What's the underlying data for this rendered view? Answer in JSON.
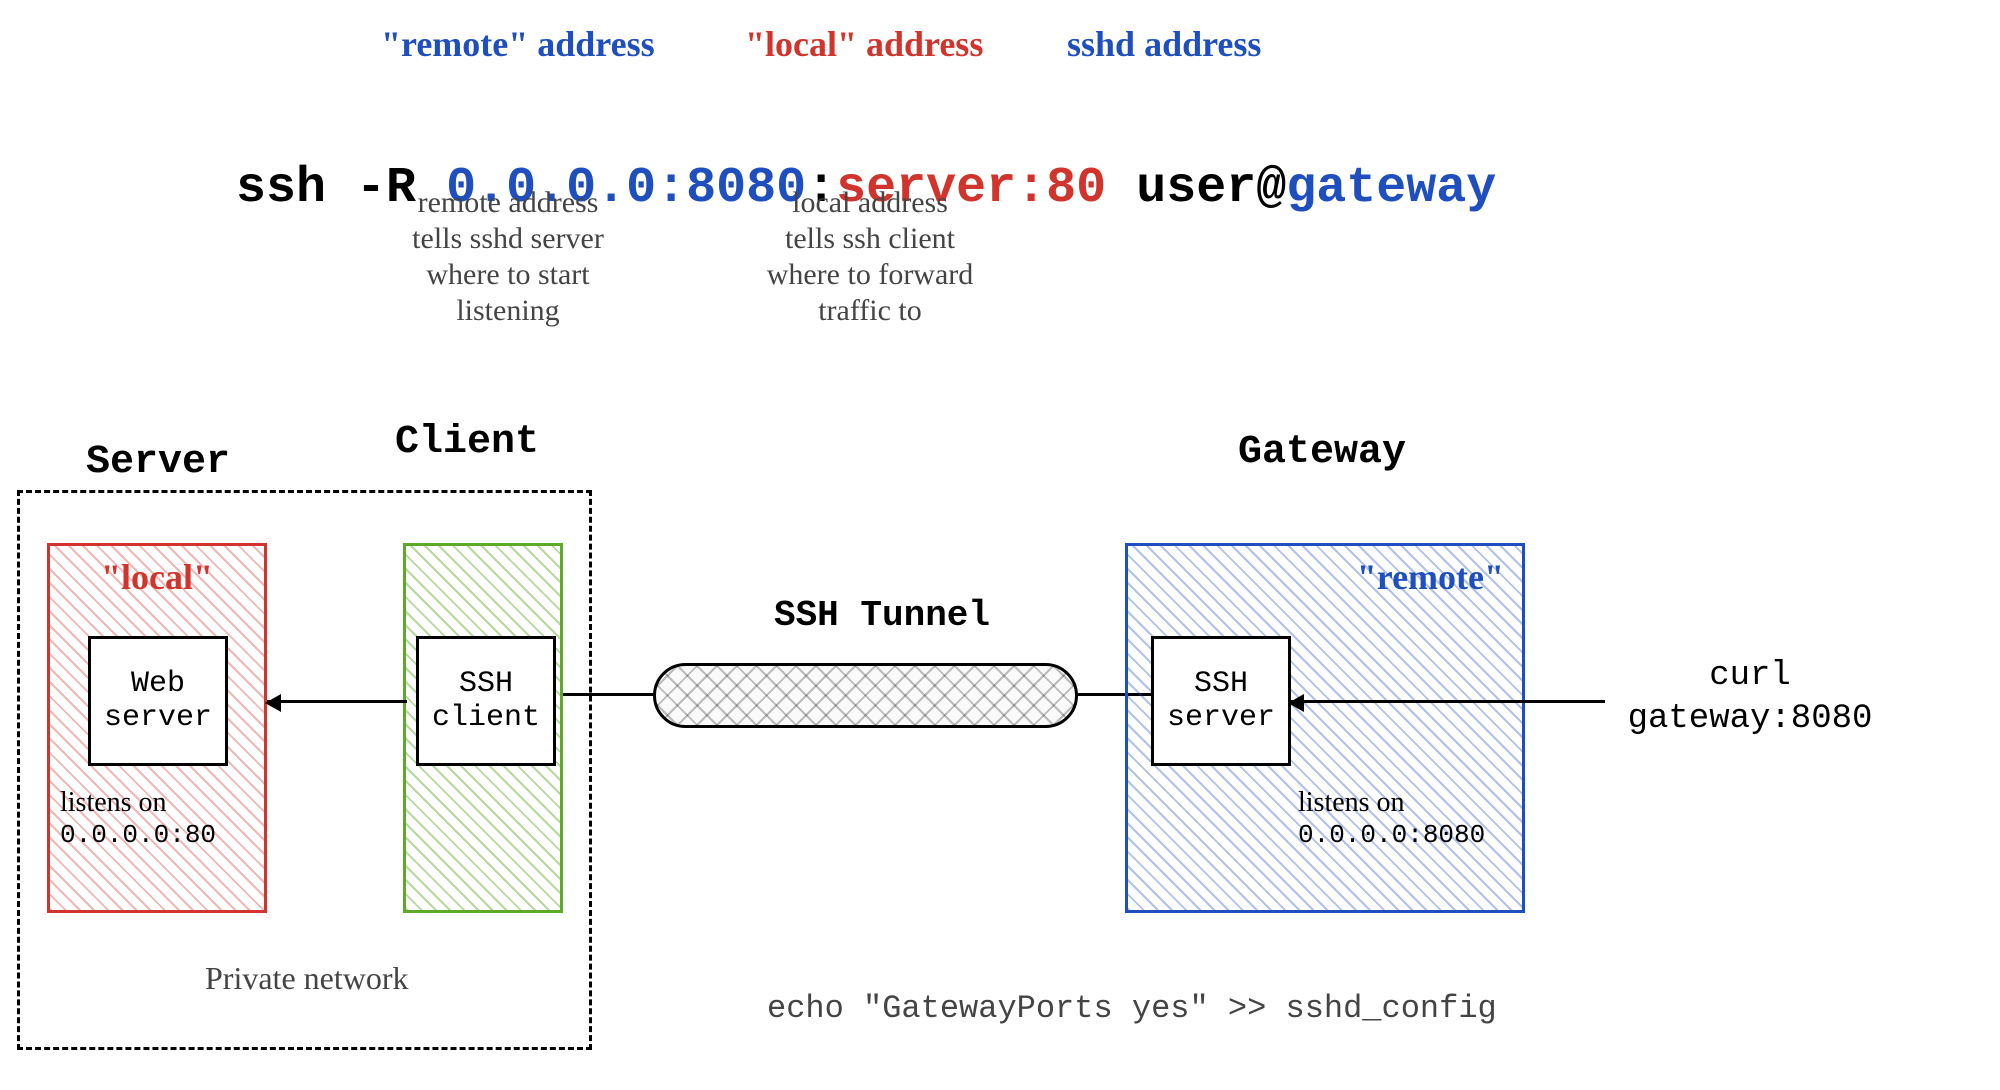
{
  "header": {
    "label_remote": "\"remote\" address",
    "label_local": "\"local\" address",
    "label_sshd": "sshd address"
  },
  "command": {
    "p1": "ssh -R ",
    "p2": "0.0.0.0:8080",
    "p3": ":",
    "p4": "server:80",
    "p5": " user@",
    "p6": "gateway"
  },
  "notes": {
    "remote_l1": "remote address",
    "remote_l2": "tells sshd server",
    "remote_l3": "where to start",
    "remote_l4": "listening",
    "local_l1": "local address",
    "local_l2": "tells ssh client",
    "local_l3": "where to forward",
    "local_l4": "traffic to"
  },
  "titles": {
    "server": "Server",
    "client": "Client",
    "gateway": "Gateway"
  },
  "serverbox": {
    "title": "\"local\"",
    "web_l1": "Web",
    "web_l2": "server",
    "listens_l1": "listens on",
    "listens_l2": "0.0.0.0:80"
  },
  "clientbox": {
    "ssh_l1": "SSH",
    "ssh_l2": "client"
  },
  "tunnel": {
    "label": "SSH Tunnel"
  },
  "gatewaybox": {
    "title": "\"remote\"",
    "ssh_l1": "SSH",
    "ssh_l2": "server",
    "listens_l1": "listens on",
    "listens_l2": "0.0.0.0:8080"
  },
  "curl": {
    "l1": "curl",
    "l2": "gateway:8080"
  },
  "footer": {
    "private": "Private network",
    "echo": "echo \"GatewayPorts yes\" >> sshd_config"
  }
}
